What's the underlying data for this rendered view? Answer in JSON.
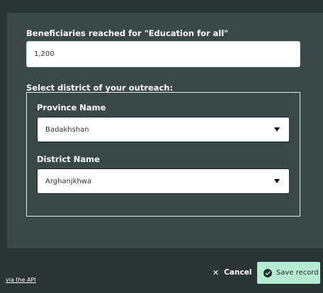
{
  "form": {
    "beneficiaries_label": "Beneficiaries reached for \"Education for all\"",
    "beneficiaries_value": "1,200",
    "district_section_label": "Select district of your outreach:",
    "province": {
      "label": "Province Name",
      "selected": "Badakhshan"
    },
    "district": {
      "label": "District Name",
      "selected": "Arghanjkhwa"
    }
  },
  "footer": {
    "api_link": "via the API",
    "cancel_label": "Cancel",
    "save_label": "Save record"
  },
  "icons": {
    "cancel": "close-icon",
    "save": "check-circle-icon",
    "dropdown": "caret-down-icon"
  },
  "colors": {
    "page_background": "#2a3534",
    "panel_background": "#3b4848",
    "save_button": "#b6ecd4"
  }
}
